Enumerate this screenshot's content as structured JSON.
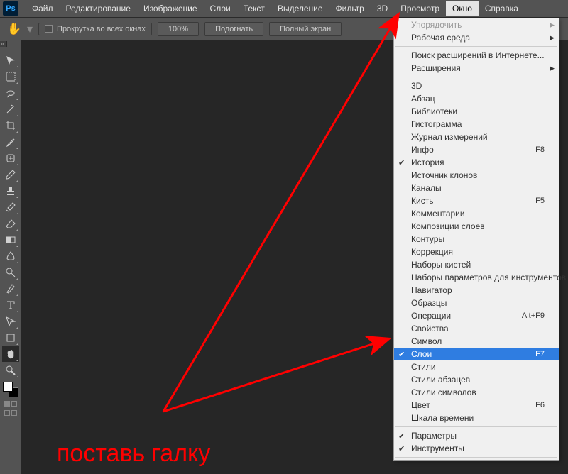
{
  "app": {
    "logo": "Ps"
  },
  "menubar": {
    "items": [
      "Файл",
      "Редактирование",
      "Изображение",
      "Слои",
      "Текст",
      "Выделение",
      "Фильтр",
      "3D",
      "Просмотр",
      "Окно",
      "Справка"
    ],
    "active_index": 9
  },
  "options": {
    "checkbox_label": "Прокрутка во всех окнах",
    "buttons": [
      "100%",
      "Подогнать",
      "Полный экран"
    ]
  },
  "toolbar": {
    "tools": [
      "move",
      "marquee",
      "lasso",
      "wand",
      "crop",
      "eyedrop",
      "heal",
      "brush",
      "stamp",
      "history",
      "eraser",
      "gradient",
      "blur",
      "dodge",
      "pen",
      "type",
      "path",
      "shape",
      "hand",
      "zoom"
    ],
    "active": "hand"
  },
  "dropdown": {
    "groups": [
      [
        {
          "label": "Упорядочить",
          "disabled": true,
          "sub": true
        },
        {
          "label": "Рабочая среда",
          "sub": true
        }
      ],
      [
        {
          "label": "Поиск расширений в Интернете..."
        },
        {
          "label": "Расширения",
          "sub": true
        }
      ],
      [
        {
          "label": "3D"
        },
        {
          "label": "Абзац"
        },
        {
          "label": "Библиотеки"
        },
        {
          "label": "Гистограмма"
        },
        {
          "label": "Журнал измерений"
        },
        {
          "label": "Инфо",
          "shortcut": "F8"
        },
        {
          "label": "История",
          "check": true
        },
        {
          "label": "Источник клонов"
        },
        {
          "label": "Каналы"
        },
        {
          "label": "Кисть",
          "shortcut": "F5"
        },
        {
          "label": "Комментарии"
        },
        {
          "label": "Композиции слоев"
        },
        {
          "label": "Контуры"
        },
        {
          "label": "Коррекция"
        },
        {
          "label": "Наборы кистей"
        },
        {
          "label": "Наборы параметров для инструментов"
        },
        {
          "label": "Навигатор"
        },
        {
          "label": "Образцы"
        },
        {
          "label": "Операции",
          "shortcut": "Alt+F9"
        },
        {
          "label": "Свойства"
        },
        {
          "label": "Символ"
        },
        {
          "label": "Слои",
          "shortcut": "F7",
          "check": true,
          "highlight": true
        },
        {
          "label": "Стили"
        },
        {
          "label": "Стили абзацев"
        },
        {
          "label": "Стили символов"
        },
        {
          "label": "Цвет",
          "shortcut": "F6"
        },
        {
          "label": "Шкала времени"
        }
      ],
      [
        {
          "label": "Параметры",
          "check": true
        },
        {
          "label": "Инструменты",
          "check": true
        }
      ]
    ]
  },
  "annotation": {
    "text": "поставь галку"
  },
  "colors": {
    "accent": "#ff0000",
    "highlight": "#2f7de1"
  }
}
